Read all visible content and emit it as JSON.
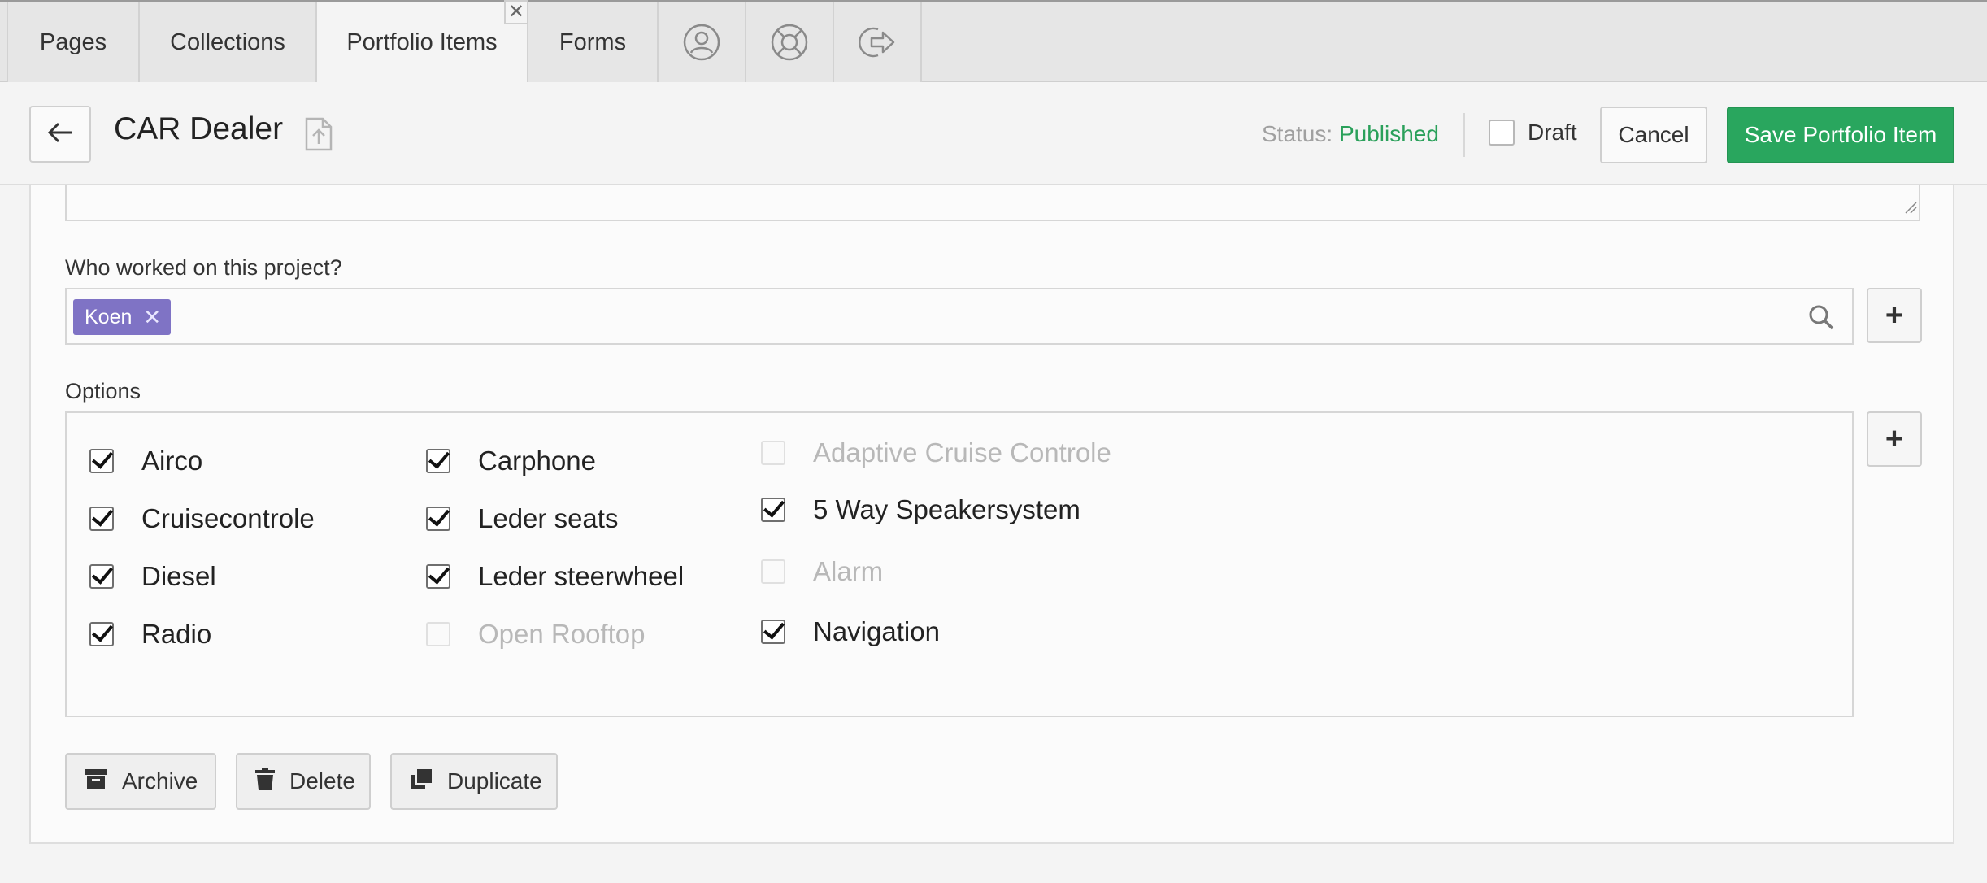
{
  "tabs": [
    {
      "label": "Pages"
    },
    {
      "label": "Collections"
    },
    {
      "label": "Portfolio Items",
      "active": true
    },
    {
      "label": "Forms"
    }
  ],
  "tab_icons": [
    "user-circle-icon",
    "lifebuoy-icon",
    "logout-icon"
  ],
  "tab_close_glyph": "✕",
  "header": {
    "title": "CAR Dealer",
    "status_label": "Status:",
    "status_value": "Published",
    "draft_label": "Draft",
    "cancel_label": "Cancel",
    "save_label": "Save Portfolio Item"
  },
  "form": {
    "workers_label": "Who worked on this project?",
    "workers": [
      "Koen"
    ],
    "chip_remove_glyph": "✕",
    "options_label": "Options",
    "add_glyph": "+",
    "options": [
      {
        "label": "Airco",
        "checked": true
      },
      {
        "label": "Cruisecontrole",
        "checked": true
      },
      {
        "label": "Diesel",
        "checked": true
      },
      {
        "label": "Radio",
        "checked": true
      },
      {
        "label": "Carphone",
        "checked": true
      },
      {
        "label": "Leder seats",
        "checked": true
      },
      {
        "label": "Leder steerwheel",
        "checked": true
      },
      {
        "label": "Open Rooftop",
        "checked": false
      },
      {
        "label": "Adaptive Cruise Controle",
        "checked": false
      },
      {
        "label": "5 Way Speakersystem",
        "checked": true
      },
      {
        "label": "Alarm",
        "checked": false
      },
      {
        "label": "Navigation",
        "checked": true
      }
    ]
  },
  "actions": {
    "archive_label": "Archive",
    "delete_label": "Delete",
    "duplicate_label": "Duplicate"
  },
  "colors": {
    "accent_green": "#29a65e",
    "chip_purple": "#7f73c5",
    "status_published": "#2aa05a"
  }
}
